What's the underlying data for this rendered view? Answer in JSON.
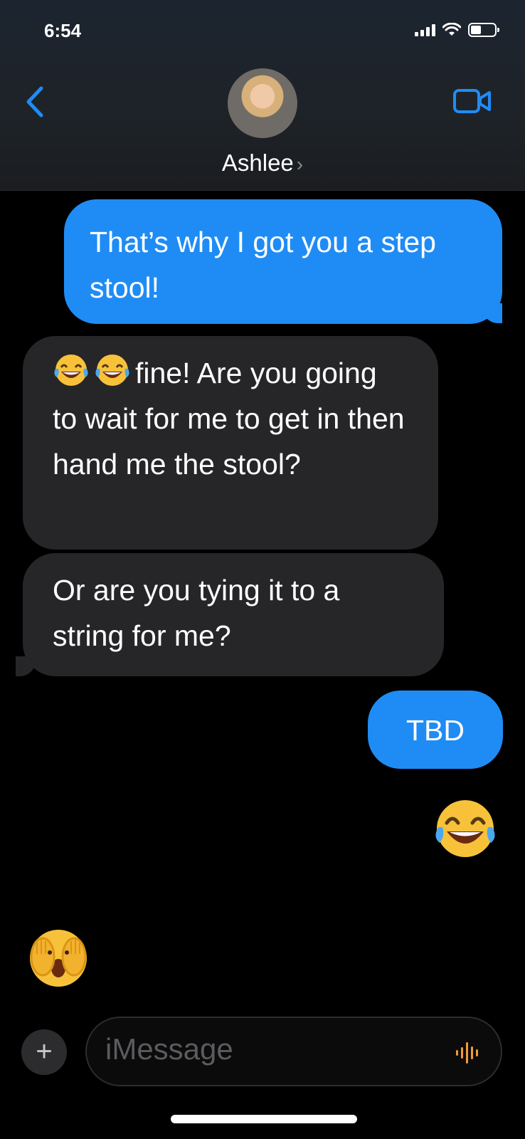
{
  "status_bar": {
    "time": "6:54"
  },
  "header": {
    "contact_name": "Ashlee",
    "chevron": "›"
  },
  "messages": [
    {
      "direction": "outgoing",
      "text": "That’s why I got you a step stool!"
    },
    {
      "direction": "incoming",
      "emoji_prefix": "😂😂",
      "text": "fine!  Are you going to wait for me to get in then hand me the stool?"
    },
    {
      "direction": "incoming",
      "text": "Or are you tying it to a string for me?"
    },
    {
      "direction": "outgoing",
      "text": "TBD"
    },
    {
      "direction": "outgoing",
      "emoji": "face-with-tears-of-joy"
    },
    {
      "direction": "incoming",
      "emoji": "face-with-hands-over-eyes"
    }
  ],
  "composer": {
    "plus_label": "+",
    "placeholder": "iMessage"
  },
  "colors": {
    "outgoing_bubble": "#1f8cf5",
    "incoming_bubble": "#262628",
    "accent": "#1f8cf5",
    "mic": "#f29a3b"
  }
}
